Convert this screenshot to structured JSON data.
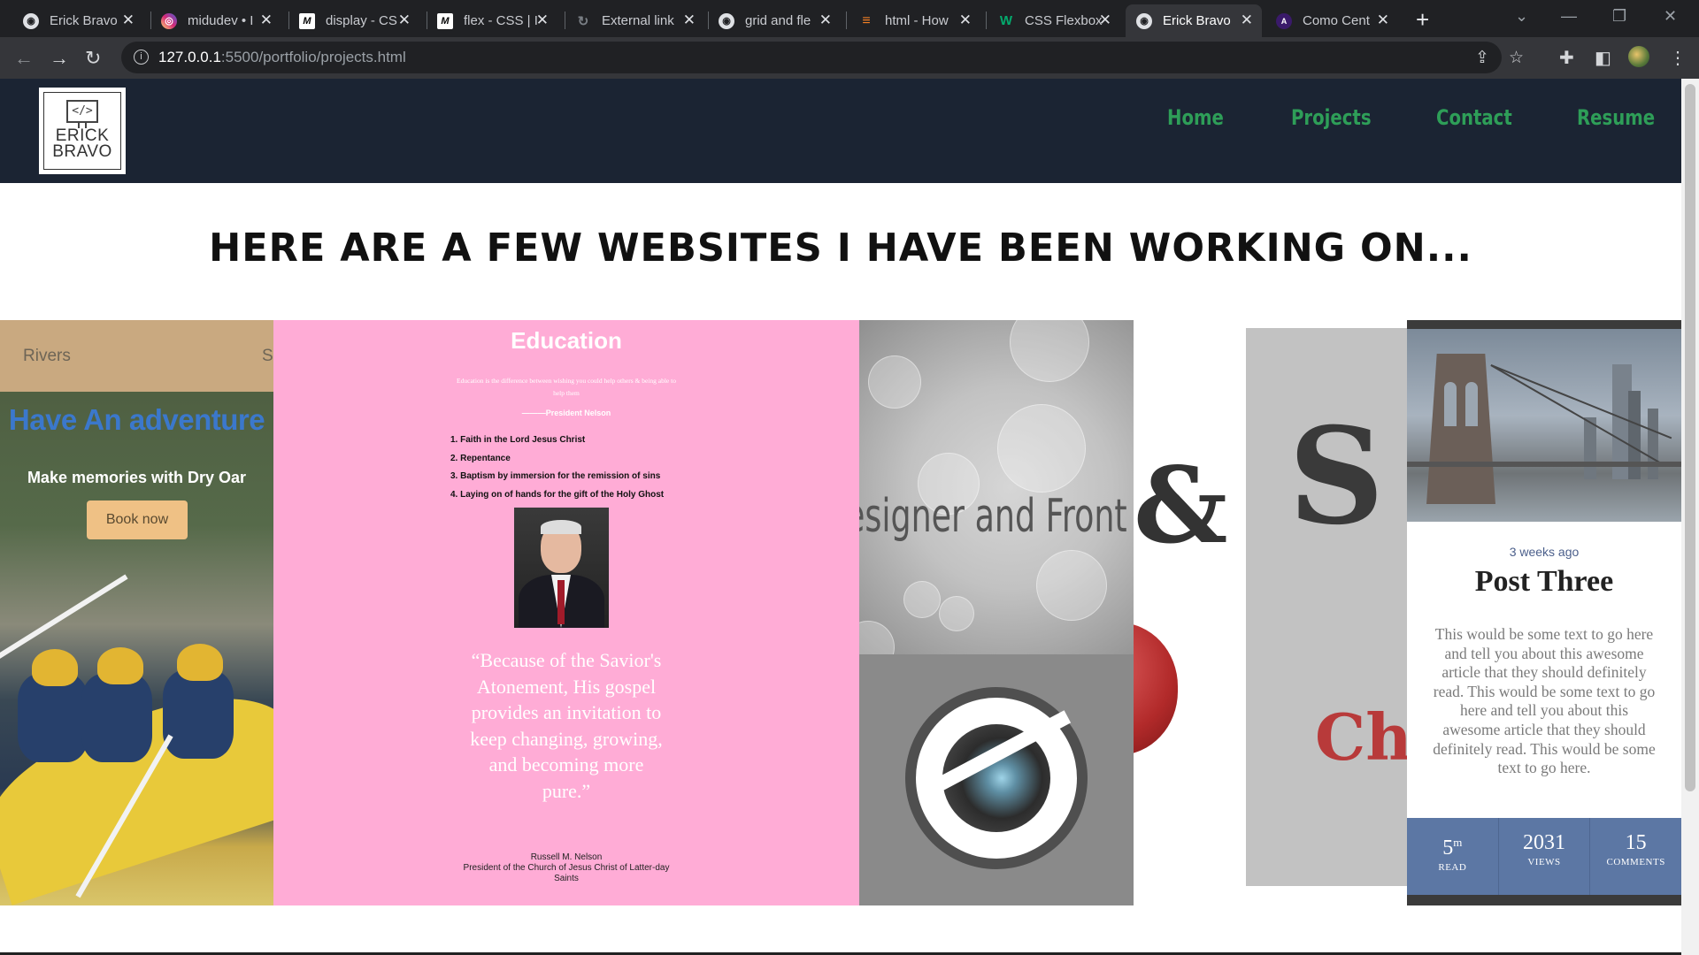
{
  "browser": {
    "tabs": [
      {
        "title": "Erick Bravo",
        "icon": "globe-icon",
        "color": "#9aa0a6",
        "active": false
      },
      {
        "title": "midudev • I",
        "icon": "instagram-icon",
        "color": "#d6249f",
        "active": false
      },
      {
        "title": "display - CS",
        "icon": "mdn-icon",
        "color": "#ffffff",
        "active": false
      },
      {
        "title": "flex - CSS | I",
        "icon": "mdn-icon",
        "color": "#ffffff",
        "active": false
      },
      {
        "title": "External link",
        "icon": "link-icon",
        "color": "#9aa0a6",
        "active": false
      },
      {
        "title": "grid and fle",
        "icon": "globe-icon",
        "color": "#9aa0a6",
        "active": false
      },
      {
        "title": "html - How",
        "icon": "stackoverflow-icon",
        "color": "#f48024",
        "active": false
      },
      {
        "title": "CSS Flexbox",
        "icon": "w3schools-icon",
        "color": "#04aa6d",
        "active": false
      },
      {
        "title": "Erick Bravo",
        "icon": "globe-icon",
        "color": "#9aa0a6",
        "active": true
      },
      {
        "title": "Como Cent",
        "icon": "angular-icon",
        "color": "#c3002f",
        "active": false
      }
    ],
    "url_host": "127.0.0.1",
    "url_path": ":5500/portfolio/projects.html"
  },
  "site": {
    "logo_line1": "ERICK",
    "logo_line2": "BRAVO",
    "logo_code": "</>",
    "nav": [
      "Home",
      "Projects",
      "Contact",
      "Resume"
    ],
    "nav_color": "#2e9e58",
    "header_bg": "#1b2433",
    "headline": "Here are a few websites I have been working on..."
  },
  "cards": {
    "adventure": {
      "nav_left": "Rivers",
      "nav_right": "S",
      "heading": "Have An adventure",
      "subtitle": "Make memories with Dry Oar",
      "button": "Book now"
    },
    "education": {
      "title": "Education",
      "quote": "Education is the difference between wishing you could help others & being able to help them",
      "author": "———President Nelson",
      "items": [
        "1. Faith in the Lord Jesus Christ",
        "2. Repentance",
        "3. Baptism by immersion for the remission of sins",
        "4. Laying on of hands for the gift of the Holy Ghost"
      ],
      "big_quote": "“Because of the Savior's Atonement, His gospel provides an invitation to keep changing, growing, and becoming more pure.”",
      "signature_name": "Russell M. Nelson",
      "signature_title": "President of the Church of Jesus Christ of Latter-day Saints"
    },
    "designer": {
      "text": "esigner and Front"
    },
    "ampersand": {
      "glyph": "&"
    },
    "serif": {
      "glyph": "S",
      "glyph2": "Ch"
    },
    "post": {
      "date": "3 weeks ago",
      "title": "Post Three",
      "body": "This would be some text to go here and tell you about this awesome article that they should definitely read. This would be some text to go here and tell you about this awesome article that they should definitely read. This would be some text to go here.",
      "stats": [
        {
          "value": "5",
          "sup": "m",
          "label": "READ"
        },
        {
          "value": "2031",
          "sup": "",
          "label": "VIEWS"
        },
        {
          "value": "15",
          "sup": "",
          "label": "COMMENTS"
        }
      ],
      "stats_color": "#5c77a4"
    }
  }
}
